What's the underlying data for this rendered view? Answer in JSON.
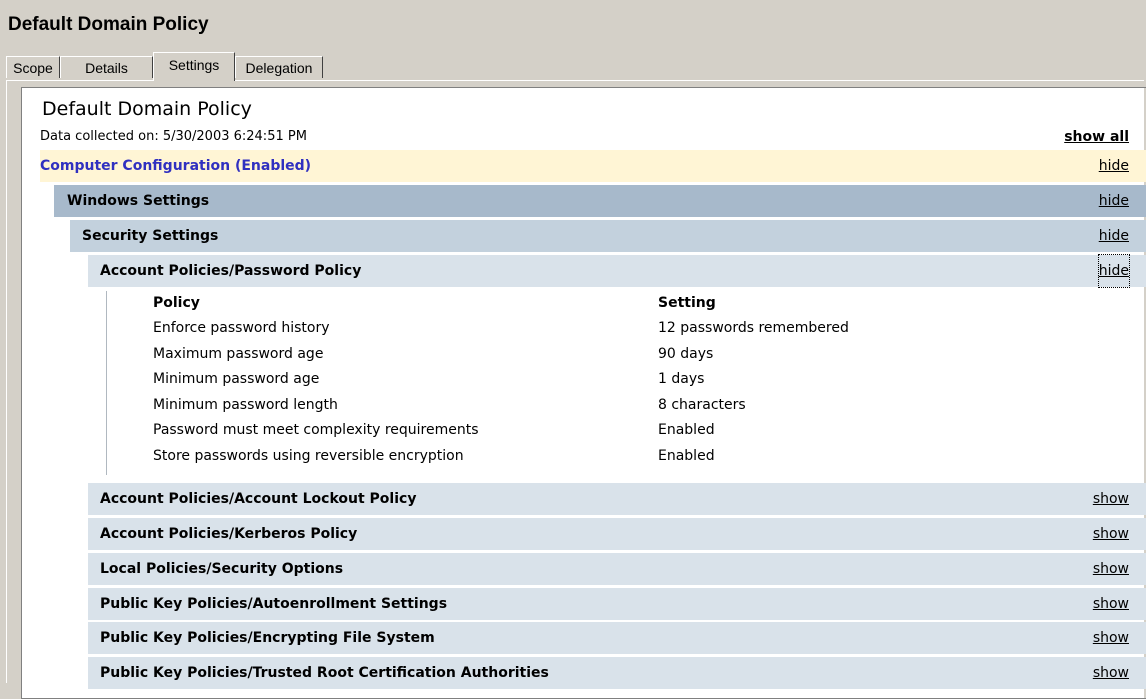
{
  "window": {
    "title": "Default Domain Policy"
  },
  "tabs": [
    {
      "label": "Scope"
    },
    {
      "label": "Details"
    },
    {
      "label": "Settings",
      "active": true
    },
    {
      "label": "Delegation"
    }
  ],
  "report": {
    "title": "Default Domain Policy",
    "collected": "Data collected on: 5/30/2003 6:24:51 PM",
    "show_all": "show all"
  },
  "sections": {
    "computer": {
      "label": "Computer Configuration (Enabled)",
      "toggle": "hide"
    },
    "windows": {
      "label": "Windows Settings",
      "toggle": "hide"
    },
    "security": {
      "label": "Security Settings",
      "toggle": "hide"
    },
    "password_policy": {
      "label": "Account Policies/Password Policy",
      "toggle": "hide"
    }
  },
  "policy_table": {
    "headers": [
      "Policy",
      "Setting"
    ],
    "rows": [
      [
        "Enforce password history",
        "12 passwords remembered"
      ],
      [
        "Maximum password age",
        "90 days"
      ],
      [
        "Minimum password age",
        "1 days"
      ],
      [
        "Minimum password length",
        "8 characters"
      ],
      [
        "Password must meet complexity requirements",
        "Enabled"
      ],
      [
        "Store passwords using reversible encryption",
        "Enabled"
      ]
    ]
  },
  "collapsed_sections": [
    {
      "label": "Account Policies/Account Lockout Policy",
      "toggle": "show"
    },
    {
      "label": "Account Policies/Kerberos Policy",
      "toggle": "show"
    },
    {
      "label": "Local Policies/Security Options",
      "toggle": "show"
    },
    {
      "label": "Public Key Policies/Autoenrollment Settings",
      "toggle": "show"
    },
    {
      "label": "Public Key Policies/Encrypting File System",
      "toggle": "show"
    },
    {
      "label": "Public Key Policies/Trusted Root Certification Authorities",
      "toggle": "show"
    }
  ],
  "colors": {
    "computer_row_bg": "#fff5d5",
    "computer_row_text": "#3030c0",
    "windows_row_bg": "#a7b9cb",
    "security_row_bg": "#c3d1dd",
    "subsection_row_bg": "#d9e2ea"
  }
}
